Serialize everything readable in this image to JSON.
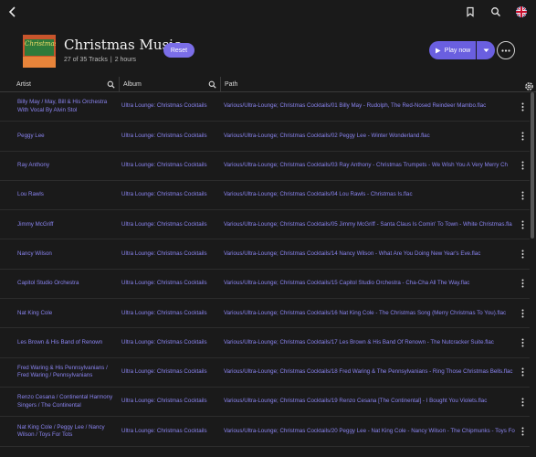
{
  "header": {
    "title": "Christmas Music",
    "track_count": "27 of 35 Tracks",
    "duration": "2 hours",
    "reset_label": "Reset",
    "play_label": "Play now",
    "art_text": "Christmas"
  },
  "columns": {
    "artist": "Artist",
    "album": "Album",
    "path": "Path"
  },
  "rows": [
    {
      "artist": "Billy May / May, Bill & His Orchestra With Vocal By Alvin Stol",
      "album": "Ultra Lounge: Christmas Cocktails",
      "path": "Various/Ultra-Lounge; Christmas Cocktails/01 Billy May - Rudolph, The Red-Nosed Reindeer Mambo.flac"
    },
    {
      "artist": "Peggy Lee",
      "album": "Ultra Lounge: Christmas Cocktails",
      "path": "Various/Ultra-Lounge; Christmas Cocktails/02 Peggy Lee - Winter Wonderland.flac"
    },
    {
      "artist": "Ray Anthony",
      "album": "Ultra Lounge: Christmas Cocktails",
      "path": "Various/Ultra-Lounge; Christmas Cocktails/03 Ray Anthony - Christmas Trumpets - We Wish You A Very Merry Ch"
    },
    {
      "artist": "Lou Rawls",
      "album": "Ultra Lounge: Christmas Cocktails",
      "path": "Various/Ultra-Lounge; Christmas Cocktails/04 Lou Rawls - Christmas Is.flac"
    },
    {
      "artist": "Jimmy McGriff",
      "album": "Ultra Lounge: Christmas Cocktails",
      "path": "Various/Ultra-Lounge; Christmas Cocktails/05 Jimmy McGriff - Santa Claus Is Comin' To Town - White Christmas.fla"
    },
    {
      "artist": "Nancy Wilson",
      "album": "Ultra Lounge: Christmas Cocktails",
      "path": "Various/Ultra-Lounge; Christmas Cocktails/14 Nancy Wilson - What Are You Doing New Year's Eve.flac"
    },
    {
      "artist": "Capitol Studio Orchestra",
      "album": "Ultra Lounge: Christmas Cocktails",
      "path": "Various/Ultra-Lounge; Christmas Cocktails/15 Capitol Studio Orchestra - Cha-Cha All The Way.flac"
    },
    {
      "artist": "Nat King Cole",
      "album": "Ultra Lounge: Christmas Cocktails",
      "path": "Various/Ultra-Lounge; Christmas Cocktails/16 Nat King Cole - The Christmas Song (Merry Christmas To You).flac"
    },
    {
      "artist": "Les Brown & His Band of Renown",
      "album": "Ultra Lounge: Christmas Cocktails",
      "path": "Various/Ultra-Lounge; Christmas Cocktails/17 Les Brown & His Band Of Renown - The Nutcracker Suite.flac"
    },
    {
      "artist": "Fred Waring & His Pennsylvanians / Fred Waring / Pennsylvanians",
      "album": "Ultra Lounge: Christmas Cocktails",
      "path": "Various/Ultra-Lounge; Christmas Cocktails/18 Fred Waring & The Pennsylvanians - Ring Those Christmas Bells.flac"
    },
    {
      "artist": "Renzo Cesana / Continental Harmony Singers / The Continental",
      "album": "Ultra Lounge: Christmas Cocktails",
      "path": "Various/Ultra-Lounge; Christmas Cocktails/19 Renzo Cesana [The Continental] - I Bought You Violets.flac"
    },
    {
      "artist": "Nat King Cole / Peggy Lee / Nancy Wilson / Toys For Tots",
      "album": "Ultra Lounge: Christmas Cocktails",
      "path": "Various/Ultra-Lounge; Christmas Cocktails/20 Peggy Lee - Nat King Cole - Nancy Wilson - The Chipmunks - Toys Fo"
    }
  ],
  "icons": {
    "back": "chevron-left-icon",
    "bookmark": "bookmark-icon",
    "search": "search-icon",
    "avatar": "flag-avatar-icon",
    "more": "ellipsis-icon",
    "settings": "settings-icon",
    "play": "play-icon",
    "dropdown": "chevron-down-icon"
  },
  "colors": {
    "accent": "#6a5fe0",
    "link": "#8a84f0",
    "background": "#1a1a1a"
  }
}
